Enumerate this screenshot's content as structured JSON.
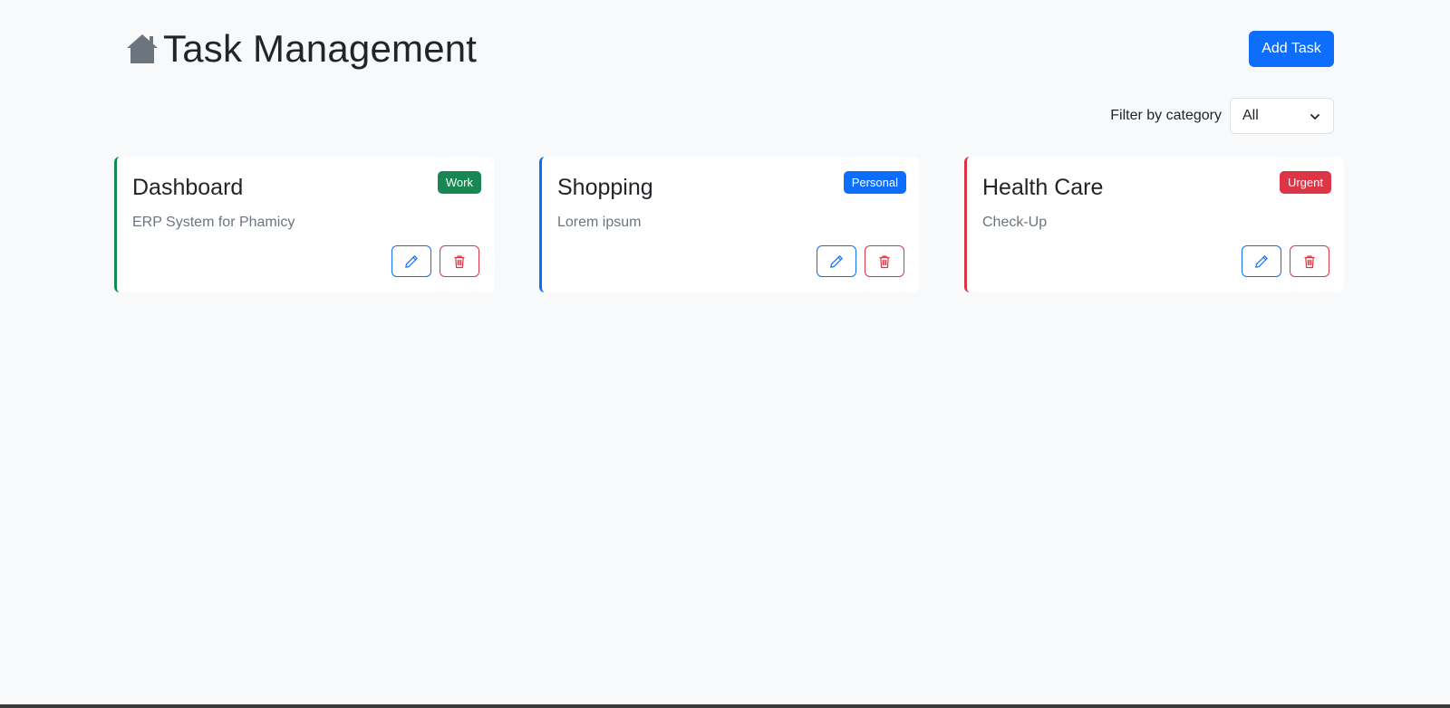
{
  "header": {
    "title": "Task Management",
    "add_button_label": "Add Task"
  },
  "filter": {
    "label": "Filter by category",
    "selected": "All"
  },
  "tasks": [
    {
      "title": "Dashboard",
      "description": "ERP System for Phamicy",
      "category": "Work",
      "color": "#198754"
    },
    {
      "title": "Shopping",
      "description": "Lorem ipsum",
      "category": "Personal",
      "color": "#0d6efd"
    },
    {
      "title": "Health Care",
      "description": "Check-Up",
      "category": "Urgent",
      "color": "#dc3545"
    }
  ],
  "icons": {
    "home": "home-icon",
    "chevron": "chevron-down-icon",
    "edit": "pencil-icon",
    "delete": "trash-icon"
  },
  "colors": {
    "primary": "#0d6efd",
    "danger": "#dc3545",
    "success": "#198754",
    "background": "#f8f9fb"
  }
}
